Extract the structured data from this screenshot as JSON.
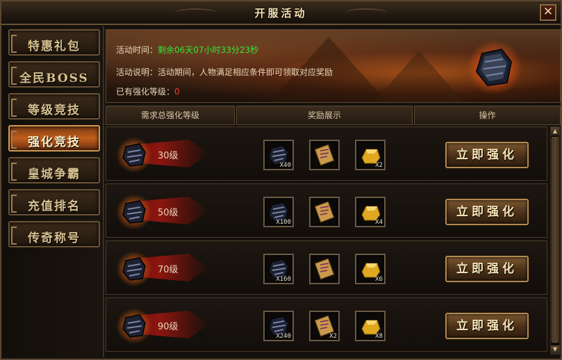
{
  "window": {
    "title": "开服活动",
    "close_label": "✕"
  },
  "sidebar": {
    "items": [
      {
        "label": "特惠礼包",
        "active": false
      },
      {
        "label": "全民BOSS",
        "active": false
      },
      {
        "label": "等级竞技",
        "active": false
      },
      {
        "label": "强化竞技",
        "active": true
      },
      {
        "label": "皇城争霸",
        "active": false
      },
      {
        "label": "充值排名",
        "active": false
      },
      {
        "label": "传奇称号",
        "active": false
      }
    ]
  },
  "banner": {
    "time_label": "活动时间：",
    "time_value": "剩余06天07小时33分23秒",
    "desc_label": "活动说明：",
    "desc_value": "活动期间，人物满足相应条件即可领取对应奖励",
    "own_label": "已有强化等级：",
    "own_value": "0"
  },
  "table": {
    "headers": [
      "需求总强化等级",
      "奖励展示",
      "操作"
    ],
    "rows": [
      {
        "level": "30级",
        "rewards": [
          "X40",
          "",
          "X2"
        ],
        "button": "立即强化"
      },
      {
        "level": "50级",
        "rewards": [
          "X100",
          "",
          "X4"
        ],
        "button": "立即强化"
      },
      {
        "level": "70级",
        "rewards": [
          "X160",
          "",
          "X6"
        ],
        "button": "立即强化"
      },
      {
        "level": "90级",
        "rewards": [
          "X240",
          "X2",
          "X8"
        ],
        "button": "立即强化"
      }
    ]
  },
  "icons": {
    "reward_items": [
      "ore-icon",
      "scroll-icon",
      "gold-ingot-icon"
    ]
  },
  "colors": {
    "accent_green": "#33e633",
    "accent_red": "#ff3a2a",
    "active_tab": "#c15f1e"
  }
}
